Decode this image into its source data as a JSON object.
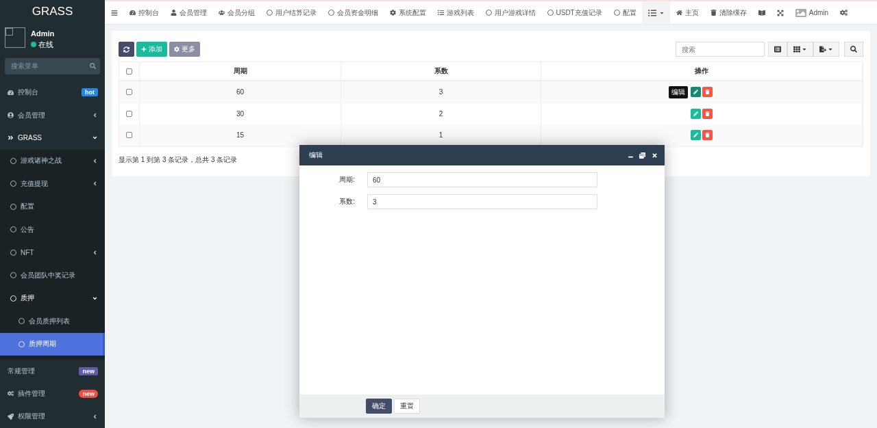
{
  "sidebar": {
    "logo": "GRASS",
    "user": {
      "name": "Admin",
      "status": "在线",
      "online": true
    },
    "search": {
      "placeholder": "搜索菜单"
    },
    "items": [
      {
        "label": "控制台",
        "selected": false,
        "badge": {
          "text": "hot",
          "color": "#1e88e5",
          "pill": false
        }
      },
      {
        "label": "会员管理",
        "selected": false,
        "expanded": false
      },
      {
        "label": "GRASS",
        "selected": false,
        "expanded": true,
        "children": [
          {
            "label": "游戏诸神之战",
            "selected": false,
            "expanded": false
          },
          {
            "label": "充值提现",
            "selected": false,
            "expanded": false
          },
          {
            "label": "配置",
            "selected": false
          },
          {
            "label": "公告",
            "selected": false
          },
          {
            "label": "NFT",
            "selected": false,
            "expanded": false
          },
          {
            "label": "会员团队中奖记录",
            "selected": false
          },
          {
            "label": "质押",
            "selected": false,
            "expanded": true,
            "children": [
              {
                "label": "会员质押列表",
                "selected": false
              },
              {
                "label": "质押周期",
                "selected": true
              }
            ]
          }
        ]
      },
      {
        "label": "常规管理",
        "selected": false,
        "badge": {
          "text": "new",
          "color": "#605ca8",
          "pill": false
        }
      },
      {
        "label": "插件管理",
        "selected": false,
        "badge": {
          "text": "new",
          "color": "#f04e3e",
          "pill": true
        }
      },
      {
        "label": "权限管理",
        "selected": false,
        "expanded": false
      }
    ]
  },
  "topnav": {
    "tabs": [
      {
        "label": "控制台",
        "selected": false
      },
      {
        "label": "会员管理",
        "selected": false
      },
      {
        "label": "会员分组",
        "selected": false
      },
      {
        "label": "用户结算记录",
        "selected": false
      },
      {
        "label": "会员资金明细",
        "selected": false
      },
      {
        "label": "系统配置",
        "selected": false
      },
      {
        "label": "游戏列表",
        "selected": false
      },
      {
        "label": "用户游戏详情",
        "selected": false
      },
      {
        "label": "USDT充值记录",
        "selected": false
      },
      {
        "label": "配置",
        "selected": false
      }
    ],
    "links": [
      "主页",
      "清除缓存"
    ],
    "user": "Admin"
  },
  "toolbar": {
    "add": "添加",
    "more": "更多",
    "search": {
      "placeholder": "搜索"
    }
  },
  "table": {
    "columns": [
      "周期",
      "系数",
      "操作"
    ],
    "header_checked": false,
    "rows": [
      {
        "cells": [
          "60",
          "3"
        ],
        "checked": false,
        "hovered": true
      },
      {
        "cells": [
          "30",
          "2"
        ],
        "checked": false,
        "hovered": false
      },
      {
        "cells": [
          "15",
          "1"
        ],
        "checked": false,
        "hovered": false
      }
    ],
    "tooltip": "编辑",
    "summary": "显示第 1 到第 3 条记录，总共 3 条记录"
  },
  "dialog": {
    "title": "编辑",
    "fields": [
      {
        "label": "周期:",
        "value": "60"
      },
      {
        "label": "系数:",
        "value": "3"
      }
    ],
    "buttons": [
      {
        "label": "确定",
        "kind": "primary"
      },
      {
        "label": "重置",
        "kind": "default"
      }
    ]
  }
}
